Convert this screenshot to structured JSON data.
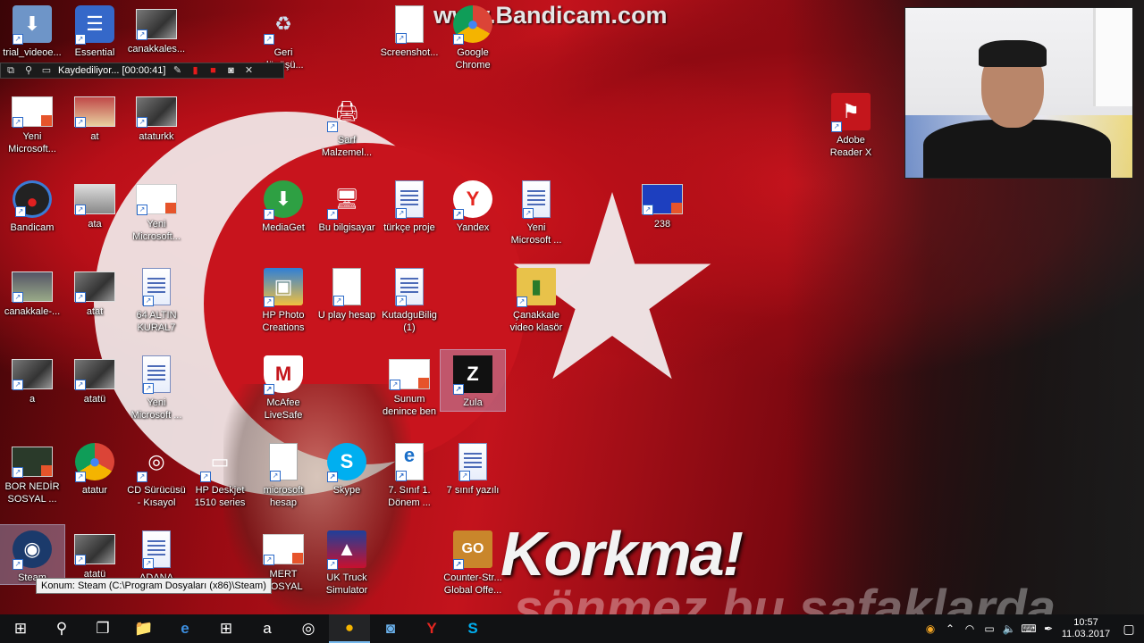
{
  "watermark": "www.Bandicam.com",
  "wallpaper": {
    "line1": "Korkma!",
    "line2": "sönmez bu şafaklarda"
  },
  "recorder": {
    "status": "Kaydediliyor... [00:00:41]"
  },
  "tooltip": "Konum: Steam (C:\\Program Dosyaları (x86)\\Steam)",
  "icons": [
    {
      "label": "trial_videoe...",
      "glyph": "⬇"
    },
    {
      "label": "Essential",
      "glyph": "☰"
    },
    {
      "label": "canakkales...",
      "glyph": ""
    },
    {
      "label": "Geri\ndönüşü...",
      "glyph": "♻"
    },
    {
      "label": "Screenshot...",
      "glyph": ""
    },
    {
      "label": "Google\nChrome",
      "glyph": "●"
    },
    {
      "label": "Yeni\nMicrosoft...",
      "glyph": ""
    },
    {
      "label": "at",
      "glyph": ""
    },
    {
      "label": "ataturkk",
      "glyph": ""
    },
    {
      "label": "Sarf\nMalzemel...",
      "glyph": "🖨"
    },
    {
      "label": "Adobe\nReader X",
      "glyph": "⚑"
    },
    {
      "label": "Bandicam",
      "glyph": "●"
    },
    {
      "label": "ata",
      "glyph": ""
    },
    {
      "label": "Yeni\nMicrosoft...",
      "glyph": ""
    },
    {
      "label": "MediaGet",
      "glyph": "⬇"
    },
    {
      "label": "Bu bilgisayar",
      "glyph": "🖥"
    },
    {
      "label": "türkçe proje",
      "glyph": ""
    },
    {
      "label": "Yandex",
      "glyph": "Y"
    },
    {
      "label": "Yeni\nMicrosoft ...",
      "glyph": ""
    },
    {
      "label": "238",
      "glyph": ""
    },
    {
      "label": "canakkale-...",
      "glyph": ""
    },
    {
      "label": "atat",
      "glyph": ""
    },
    {
      "label": "64 ALTIN\nKURAL7",
      "glyph": ""
    },
    {
      "label": "HP Photo\nCreations",
      "glyph": "▣"
    },
    {
      "label": "U play hesap",
      "glyph": ""
    },
    {
      "label": "KutadguBilig\n(1)",
      "glyph": ""
    },
    {
      "label": "Çanakkale\nvideo klasör",
      "glyph": "▮"
    },
    {
      "label": "a",
      "glyph": ""
    },
    {
      "label": "atatü",
      "glyph": ""
    },
    {
      "label": "Yeni\nMicrosoft ...",
      "glyph": ""
    },
    {
      "label": "McAfee\nLiveSafe",
      "glyph": "M"
    },
    {
      "label": "Sunum\ndenince ben",
      "glyph": ""
    },
    {
      "label": "Zula",
      "glyph": "Z"
    },
    {
      "label": "BOR NEDİR\nSOSYAL ...",
      "glyph": ""
    },
    {
      "label": "atatur",
      "glyph": "●"
    },
    {
      "label": "CD Sürücüsü\n- Kısayol",
      "glyph": "◎"
    },
    {
      "label": "HP Deskjet\n1510 series",
      "glyph": "▭"
    },
    {
      "label": "microsoft\nhesap",
      "glyph": ""
    },
    {
      "label": "Skype",
      "glyph": "S"
    },
    {
      "label": "7. Sınıf 1.\nDönem ...",
      "glyph": "e"
    },
    {
      "label": "7 sınıf yazılı",
      "glyph": ""
    },
    {
      "label": "Steam",
      "glyph": "◉"
    },
    {
      "label": "atatü",
      "glyph": ""
    },
    {
      "label": "ADANA",
      "glyph": ""
    },
    {
      "label": "MERT\nSOSYAL",
      "glyph": ""
    },
    {
      "label": "UK Truck\nSimulator",
      "glyph": "▲"
    },
    {
      "label": "Counter-Str...\nGlobal Offe...",
      "glyph": "GO"
    }
  ],
  "taskbar": {
    "items": [
      "⊞",
      "⚲",
      "❐",
      "📁",
      "e",
      "⊞",
      "a",
      "◎",
      "●",
      "◙",
      "Y",
      "S"
    ],
    "clock_time": "10:57",
    "clock_date": "11.03.2017"
  },
  "colors": {
    "flag_red": "#c8141d",
    "flag_white": "#f1ecec",
    "taskbar": "#111214"
  }
}
